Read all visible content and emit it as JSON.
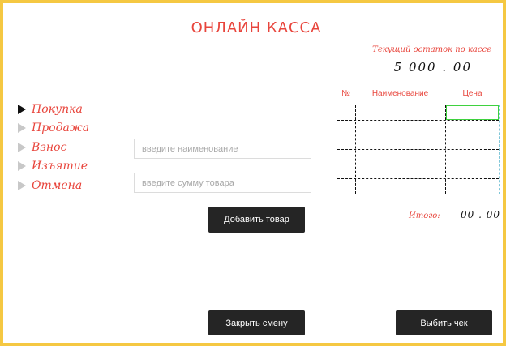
{
  "app": {
    "title": "ОНЛАЙН КАССА",
    "border_color": "#f5c842",
    "accent_color": "#e8453c"
  },
  "balance": {
    "label": "Текущий остаток по кассе",
    "value": "5 000 . 00"
  },
  "menu": {
    "items": [
      {
        "label": "Покупка",
        "active": true
      },
      {
        "label": "Продажа",
        "active": false
      },
      {
        "label": "Взнос",
        "active": false
      },
      {
        "label": "Изъятие",
        "active": false
      },
      {
        "label": "Отмена",
        "active": false
      }
    ]
  },
  "form": {
    "name_placeholder": "введите наименование",
    "name_value": "",
    "price_placeholder": "введите сумму товара",
    "price_value": "",
    "add_button": "Добавить товар"
  },
  "table": {
    "headers": [
      "№",
      "Наименование",
      "Цена"
    ],
    "row_count": 6
  },
  "total": {
    "label": "Итого:",
    "value": "00 . 00"
  },
  "actions": {
    "close_shift": "Закрыть смену",
    "print_receipt": "Выбить чек"
  }
}
